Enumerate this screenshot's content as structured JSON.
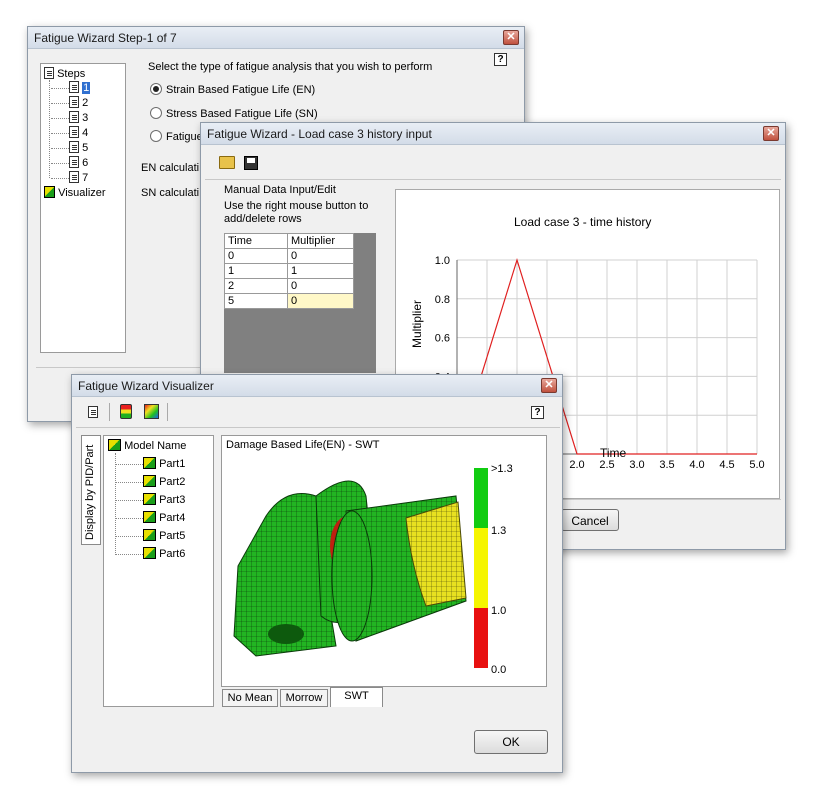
{
  "wiz1": {
    "title": "Fatigue Wizard Step-1 of 7",
    "close": "✕",
    "tree_root": "Steps",
    "steps": [
      "1",
      "2",
      "3",
      "4",
      "5",
      "6",
      "7"
    ],
    "visualizer": "Visualizer",
    "prompt": "Select the type of fatigue analysis that you wish to perform",
    "options": [
      "Strain Based Fatigue Life (EN)",
      "Stress Based Fatigue Life (SN)",
      "Fatigue"
    ],
    "en_label": "EN calculati",
    "sn_label": "SN calculati"
  },
  "wiz2": {
    "title": "Fatigue Wizard  - Load case 3 history input",
    "close": "✕",
    "group_title": "Manual Data Input/Edit",
    "hint": "Use the right mouse button to add/delete rows",
    "col_time": "Time",
    "col_mult": "Multiplier",
    "rows": [
      [
        "0",
        "0"
      ],
      [
        "1",
        "1"
      ],
      [
        "2",
        "0"
      ],
      [
        "5",
        "0"
      ]
    ],
    "cancel": "Cancel"
  },
  "chart_data": {
    "type": "line",
    "title": "Load case 3 - time history",
    "xlabel": "Time",
    "ylabel": "Multiplier",
    "x": [
      0,
      1,
      2,
      5
    ],
    "y": [
      0,
      1,
      0,
      0
    ],
    "xlim": [
      0,
      5
    ],
    "ylim": [
      0,
      1
    ],
    "xticks": [
      "2.0",
      "2.5",
      "3.0",
      "3.5",
      "4.0",
      "4.5",
      "5.0"
    ],
    "yticks": [
      "1.0",
      "0.8",
      "0.6",
      "0.4"
    ],
    "grid": true,
    "line_color": "#e02020"
  },
  "wiz3": {
    "title": "Fatigue Wizard Visualizer",
    "close": "✕",
    "side_tab": "Display by PID/Part",
    "model_name": "Model Name",
    "parts": [
      "Part1",
      "Part2",
      "Part3",
      "Part4",
      "Part5",
      "Part6"
    ],
    "view_title": "Damage Based Life(EN) - SWT",
    "legend": [
      ">1.3",
      "1.3",
      "1.0",
      "0.0"
    ],
    "legend_colors": [
      "#11cc11",
      "#f5f500",
      "#e81010"
    ],
    "tabs": [
      "No Mean",
      "Morrow",
      "SWT"
    ],
    "ok": "OK",
    "help": "?"
  }
}
